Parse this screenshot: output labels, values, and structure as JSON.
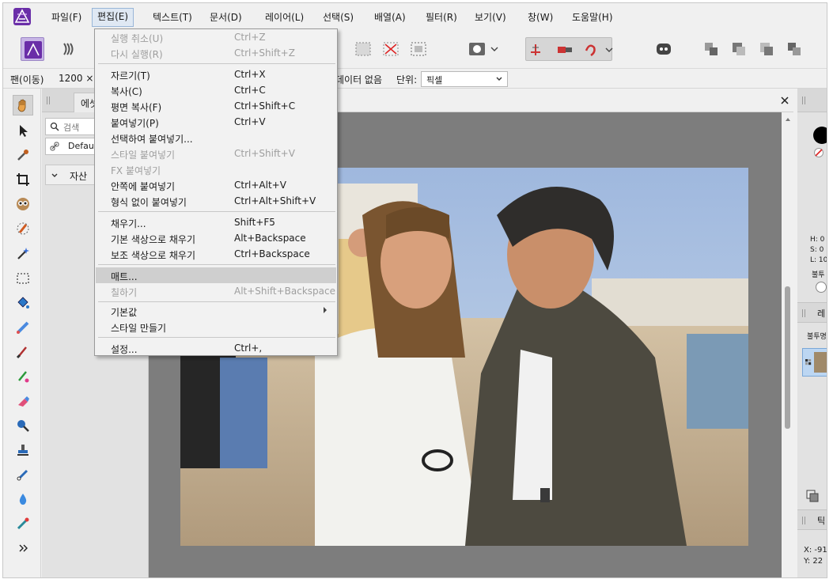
{
  "menubar": {
    "items": [
      {
        "label": "파일(F)"
      },
      {
        "label": "편집(E)"
      },
      {
        "label": "텍스트(T)"
      },
      {
        "label": "문서(D)"
      },
      {
        "label": "레이어(L)"
      },
      {
        "label": "선택(S)"
      },
      {
        "label": "배열(A)"
      },
      {
        "label": "필터(R)"
      },
      {
        "label": "보기(V)"
      },
      {
        "label": "창(W)"
      },
      {
        "label": "도움말(H)"
      }
    ]
  },
  "context_bar": {
    "tool_name": "팬(이동)",
    "zoom_value": "1200 ×",
    "data_status": "데이터 없음",
    "units_label": "단위:",
    "units_value": "픽셀"
  },
  "left_panel": {
    "tab_label": "에셋",
    "search_placeholder": "검색",
    "default_label": "Default",
    "section_label": "자산"
  },
  "edit_menu": {
    "items": [
      {
        "label": "실행 취소(U)",
        "shortcut": "Ctrl+Z",
        "enabled": false
      },
      {
        "label": "다시 실행(R)",
        "shortcut": "Ctrl+Shift+Z",
        "enabled": false
      },
      {
        "label": "자르기(T)",
        "shortcut": "Ctrl+X",
        "enabled": true
      },
      {
        "label": "복사(C)",
        "shortcut": "Ctrl+C",
        "enabled": true
      },
      {
        "label": "평면 복사(F)",
        "shortcut": "Ctrl+Shift+C",
        "enabled": true
      },
      {
        "label": "붙여넣기(P)",
        "shortcut": "Ctrl+V",
        "enabled": true
      },
      {
        "label": "선택하여 붙여넣기...",
        "shortcut": "",
        "enabled": true
      },
      {
        "label": "스타일 붙여넣기",
        "shortcut": "Ctrl+Shift+V",
        "enabled": false
      },
      {
        "label": "FX 붙여넣기",
        "shortcut": "",
        "enabled": false
      },
      {
        "label": "안쪽에 붙여넣기",
        "shortcut": "Ctrl+Alt+V",
        "enabled": true
      },
      {
        "label": "형식 없이 붙여넣기",
        "shortcut": "Ctrl+Alt+Shift+V",
        "enabled": true
      },
      {
        "label": "채우기...",
        "shortcut": "Shift+F5",
        "enabled": true
      },
      {
        "label": "기본 색상으로 채우기",
        "shortcut": "Alt+Backspace",
        "enabled": true
      },
      {
        "label": "보조 색상으로 채우기",
        "shortcut": "Ctrl+Backspace",
        "enabled": true
      },
      {
        "label": "매트...",
        "shortcut": "",
        "enabled": true,
        "highlighted": true
      },
      {
        "label": "칠하기",
        "shortcut": "Alt+Shift+Backspace",
        "enabled": false
      },
      {
        "label": "기본값",
        "shortcut": "",
        "enabled": true,
        "submenu": true
      },
      {
        "label": "스타일 만들기",
        "shortcut": "",
        "enabled": true
      },
      {
        "label": "설정...",
        "shortcut": "Ctrl+,",
        "enabled": true
      }
    ]
  },
  "right_panel": {
    "h_value": "H: 0",
    "s_value": "S: 0",
    "l_value": "L: 10",
    "opacity_label": "불투",
    "layer_tab_label": "레",
    "layer_opacity_label": "불투명",
    "transform_tab_label": "틱",
    "x_value": "X: -91",
    "y_value": "Y: 22"
  },
  "colors": {
    "accent": "#6a2ea8",
    "menu_highlight": "#cfcfcf",
    "disabled_text": "#9e9e9e",
    "canvas_bg": "#7d7d7d"
  }
}
